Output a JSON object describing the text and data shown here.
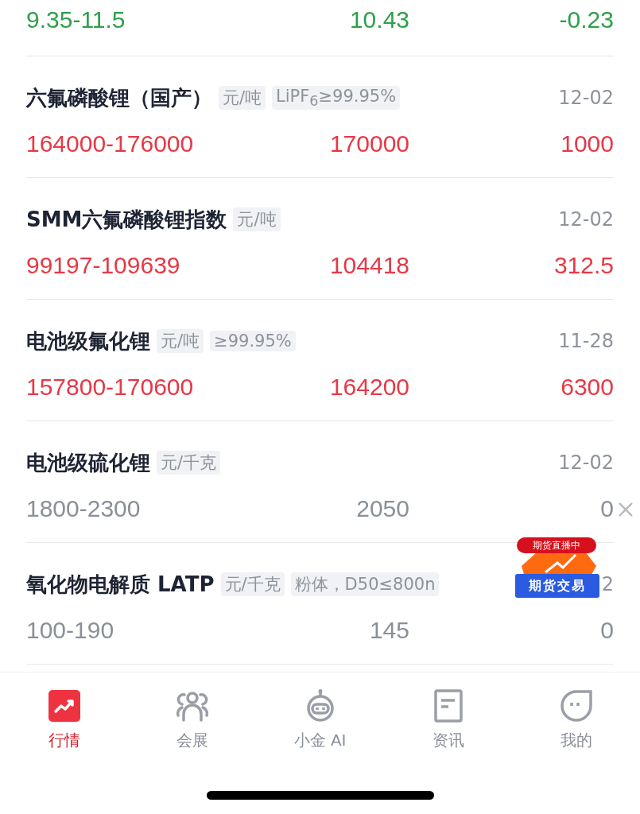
{
  "rows": [
    {
      "range": "9.35-11.5",
      "price": "10.43",
      "change": "-0.23",
      "color": "#2ea04a"
    },
    {
      "name": "六氟磷酸锂（国产）",
      "tags": [
        "元/吨",
        "LiPF$_{6}$≥99.95%"
      ],
      "date": "12-02",
      "range": "164000-176000",
      "price": "170000",
      "change": "1000",
      "color": "#e63946"
    },
    {
      "name": "SMM六氟磷酸锂指数",
      "tags": [
        "元/吨"
      ],
      "date": "12-02",
      "range": "99197-109639",
      "price": "104418",
      "change": "312.5",
      "color": "#e63946"
    },
    {
      "name": "电池级氟化锂",
      "tags": [
        "元/吨",
        "≥99.95%"
      ],
      "date": "11-28",
      "range": "157800-170600",
      "price": "164200",
      "change": "6300",
      "color": "#e63946"
    },
    {
      "name": "电池级硫化锂",
      "tags": [
        "元/千克"
      ],
      "date": "12-02",
      "range": "1800-2300",
      "price": "2050",
      "change": "0",
      "color": "#8a9099"
    },
    {
      "name": "氧化物电解质 LATP",
      "tags": [
        "元/千克",
        "粉体，D50≤800n"
      ],
      "date": "2",
      "range": "100-190",
      "price": "145",
      "change": "0",
      "color": "#8a9099"
    }
  ],
  "promo": {
    "badge": "期货直播中",
    "ribbon": "期货交易"
  },
  "nav": [
    {
      "label": "行情",
      "kind": "chart",
      "selected": true
    },
    {
      "label": "会展",
      "kind": "people",
      "selected": false
    },
    {
      "label": "小金 AI",
      "kind": "robot",
      "selected": false
    },
    {
      "label": "资讯",
      "kind": "doc",
      "selected": false
    },
    {
      "label": "我的",
      "kind": "face",
      "selected": false
    }
  ]
}
